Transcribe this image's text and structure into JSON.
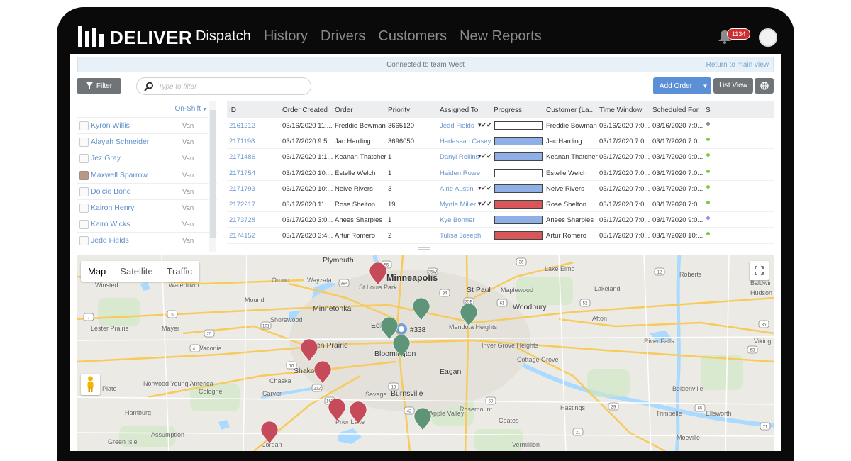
{
  "brand": {
    "name": "DELIVER"
  },
  "nav": {
    "items": [
      {
        "label": "Dispatch",
        "active": true
      },
      {
        "label": "History",
        "active": false
      },
      {
        "label": "Drivers",
        "active": false
      },
      {
        "label": "Customers",
        "active": false
      },
      {
        "label": "New Reports",
        "active": false
      }
    ],
    "notifications": "1134"
  },
  "banner": {
    "text": "Connected to team West",
    "return_link": "Return to main view"
  },
  "toolbar": {
    "filter_label": "Filter",
    "search_placeholder": "Type to filter",
    "add_order_label": "Add Order",
    "list_view_label": "List View"
  },
  "drivers": {
    "header": "On-Shift",
    "items": [
      {
        "name": "Kyron Willis",
        "vehicle": "Van",
        "photo": false
      },
      {
        "name": "Alayah Schneider",
        "vehicle": "Van",
        "photo": false
      },
      {
        "name": "Jez Gray",
        "vehicle": "Van",
        "photo": false
      },
      {
        "name": "Maxwell Sparrow",
        "vehicle": "Van",
        "photo": true
      },
      {
        "name": "Dolcie Bond",
        "vehicle": "Van",
        "photo": false
      },
      {
        "name": "Kairon Henry",
        "vehicle": "Van",
        "photo": false
      },
      {
        "name": "Kairo Wicks",
        "vehicle": "Van",
        "photo": false
      },
      {
        "name": "Jedd Fields",
        "vehicle": "Van",
        "photo": false
      }
    ]
  },
  "orders": {
    "columns": [
      "ID",
      "Order Created",
      "Order",
      "Priority",
      "Assigned To",
      "Progress",
      "Customer (La...",
      "Time Window",
      "Scheduled For",
      "S"
    ],
    "rows": [
      {
        "id": "2161212",
        "created": "03/16/2020 11:...",
        "order": "Freddie Bowman",
        "priority": "3665120",
        "assigned": "Jedd Fields",
        "checks": true,
        "progress": "white",
        "customer": "Freddie Bowman",
        "window": "03/16/2020 7:0...",
        "scheduled": "03/16/2020 7:0...",
        "status": "#888888"
      },
      {
        "id": "2171198",
        "created": "03/17/2020 9:5...",
        "order": "Jac Harding",
        "priority": "3696050",
        "assigned": "Hadassah Casey",
        "checks": false,
        "progress": "blue",
        "customer": "Jac Harding",
        "window": "03/17/2020 7:0...",
        "scheduled": "03/17/2020 7:0...",
        "status": "#7ac943"
      },
      {
        "id": "2171486",
        "created": "03/17/2020 1:1...",
        "order": "Keanan Thatcher",
        "priority": "1",
        "assigned": "Danyl Rollins",
        "checks": true,
        "progress": "blue",
        "customer": "Keanan Thatcher",
        "window": "03/17/2020 7:0...",
        "scheduled": "03/17/2020 9:0...",
        "status": "#7ac943"
      },
      {
        "id": "2171754",
        "created": "03/17/2020 10:...",
        "order": "Estelle Welch",
        "priority": "1",
        "assigned": "Haiden Rowe",
        "checks": false,
        "progress": "white",
        "customer": "Estelle Welch",
        "window": "03/17/2020 7:0...",
        "scheduled": "03/17/2020 7:0...",
        "status": "#7ac943"
      },
      {
        "id": "2171793",
        "created": "03/17/2020 10:...",
        "order": "Neive Rivers",
        "priority": "3",
        "assigned": "Aine Austin",
        "checks": true,
        "progress": "blue",
        "customer": "Neive Rivers",
        "window": "03/17/2020 7:0...",
        "scheduled": "03/17/2020 7:0...",
        "status": "#7ac943"
      },
      {
        "id": "2172217",
        "created": "03/17/2020 11:...",
        "order": "Rose Shelton",
        "priority": "19",
        "assigned": "Myrtle Miller",
        "checks": true,
        "progress": "red",
        "customer": "Rose Shelton",
        "window": "03/17/2020 7:0...",
        "scheduled": "03/17/2020 7:0...",
        "status": "#7ac943"
      },
      {
        "id": "2173728",
        "created": "03/17/2020 3:0...",
        "order": "Anees Sharples",
        "priority": "1",
        "assigned": "Kye Bonner",
        "checks": false,
        "progress": "blue",
        "customer": "Anees Sharples",
        "window": "03/17/2020 7:0...",
        "scheduled": "03/17/2020 9:0...",
        "status": "#8a8ef0"
      },
      {
        "id": "2174152",
        "created": "03/17/2020 3:4...",
        "order": "Artur Romero",
        "priority": "2",
        "assigned": "Tulisa Joseph",
        "checks": false,
        "progress": "red",
        "customer": "Artur Romero",
        "window": "03/17/2020 7:0...",
        "scheduled": "03/17/2020 10:...",
        "status": "#7ac943"
      }
    ]
  },
  "progress_colors": {
    "white": "#ffffff",
    "blue": "#8fb0e6",
    "red": "#d9575b"
  },
  "map": {
    "tabs": [
      {
        "label": "Map",
        "active": true
      },
      {
        "label": "Satellite",
        "active": false
      },
      {
        "label": "Traffic",
        "active": false
      }
    ],
    "pin_colors": {
      "red": "#c54a5a",
      "green": "#5e9477"
    },
    "center_label": "#338",
    "places": [
      {
        "name": "Plymouth",
        "size": "m"
      },
      {
        "name": "Minneapolis",
        "size": "l"
      },
      {
        "name": "St Louis Park",
        "size": "s"
      },
      {
        "name": "St Paul",
        "size": "m"
      },
      {
        "name": "Maplewood",
        "size": "s"
      },
      {
        "name": "Lake Elmo",
        "size": "s"
      },
      {
        "name": "Roberts",
        "size": "s"
      },
      {
        "name": "Baldwin",
        "size": "s"
      },
      {
        "name": "Hudson",
        "size": "s"
      },
      {
        "name": "Lakeland",
        "size": "s"
      },
      {
        "name": "Winsted",
        "size": "s"
      },
      {
        "name": "Watertown",
        "size": "s"
      },
      {
        "name": "Orono",
        "size": "s"
      },
      {
        "name": "Wayzata",
        "size": "s"
      },
      {
        "name": "Mound",
        "size": "s"
      },
      {
        "name": "Minnetonka",
        "size": "m"
      },
      {
        "name": "Woodbury",
        "size": "m"
      },
      {
        "name": "Shorewood",
        "size": "s"
      },
      {
        "name": "Lester Prairie",
        "size": "s"
      },
      {
        "name": "Mayer",
        "size": "s"
      },
      {
        "name": "Edina",
        "size": "m"
      },
      {
        "name": "Mendota Heights",
        "size": "s"
      },
      {
        "name": "Afton",
        "size": "s"
      },
      {
        "name": "Waconia",
        "size": "s"
      },
      {
        "name": "Eden Prairie",
        "size": "m"
      },
      {
        "name": "Bloomington",
        "size": "m"
      },
      {
        "name": "Inver Grove Heights",
        "size": "s"
      },
      {
        "name": "River Falls",
        "size": "s"
      },
      {
        "name": "Viking",
        "size": "s"
      },
      {
        "name": "Cottage Grove",
        "size": "s"
      },
      {
        "name": "Shakopee",
        "size": "m"
      },
      {
        "name": "Chaska",
        "size": "s"
      },
      {
        "name": "Eagan",
        "size": "m"
      },
      {
        "name": "Plato",
        "size": "s"
      },
      {
        "name": "Norwood Young America",
        "size": "s"
      },
      {
        "name": "Cologne",
        "size": "s"
      },
      {
        "name": "Carver",
        "size": "s"
      },
      {
        "name": "Savage",
        "size": "s"
      },
      {
        "name": "Burnsville",
        "size": "m"
      },
      {
        "name": "Beldenville",
        "size": "s"
      },
      {
        "name": "Rosemount",
        "size": "s"
      },
      {
        "name": "Apple Valley",
        "size": "s"
      },
      {
        "name": "Hamburg",
        "size": "s"
      },
      {
        "name": "Hastings",
        "size": "s"
      },
      {
        "name": "Trimbelle",
        "size": "s"
      },
      {
        "name": "Ellsworth",
        "size": "s"
      },
      {
        "name": "Prior Lake",
        "size": "s"
      },
      {
        "name": "Coates",
        "size": "s"
      },
      {
        "name": "Assumption",
        "size": "s"
      },
      {
        "name": "Green Isle",
        "size": "s"
      },
      {
        "name": "Jordan",
        "size": "s"
      },
      {
        "name": "Vermillion",
        "size": "s"
      },
      {
        "name": "Moeville",
        "size": "s"
      }
    ],
    "highways": [
      "55",
      "35W",
      "394",
      "94",
      "35E",
      "61",
      "52",
      "36",
      "12",
      "7",
      "5",
      "25",
      "101",
      "41",
      "10",
      "212",
      "169",
      "13",
      "42",
      "50",
      "21",
      "29",
      "35",
      "63",
      "65",
      "71"
    ]
  }
}
